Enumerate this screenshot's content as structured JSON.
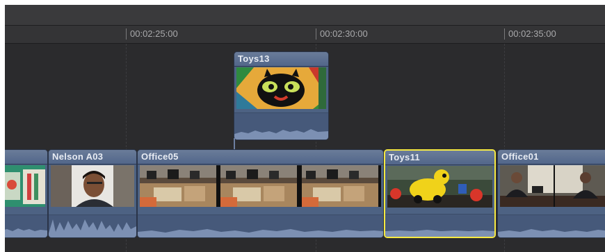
{
  "ruler": {
    "ticks": [
      "00:02:25:00",
      "00:02:30:00",
      "00:02:35:00"
    ]
  },
  "connected_clip": {
    "name": "Toys13"
  },
  "primary_clips": [
    {
      "name": ""
    },
    {
      "name": "Nelson A03"
    },
    {
      "name": "Office05"
    },
    {
      "name": "Toys11"
    },
    {
      "name": "Office01"
    }
  ],
  "selected_clip": "Toys11",
  "colors": {
    "clip": "#4d6283",
    "selection": "#f7ea42",
    "background": "#2b2b2d"
  }
}
